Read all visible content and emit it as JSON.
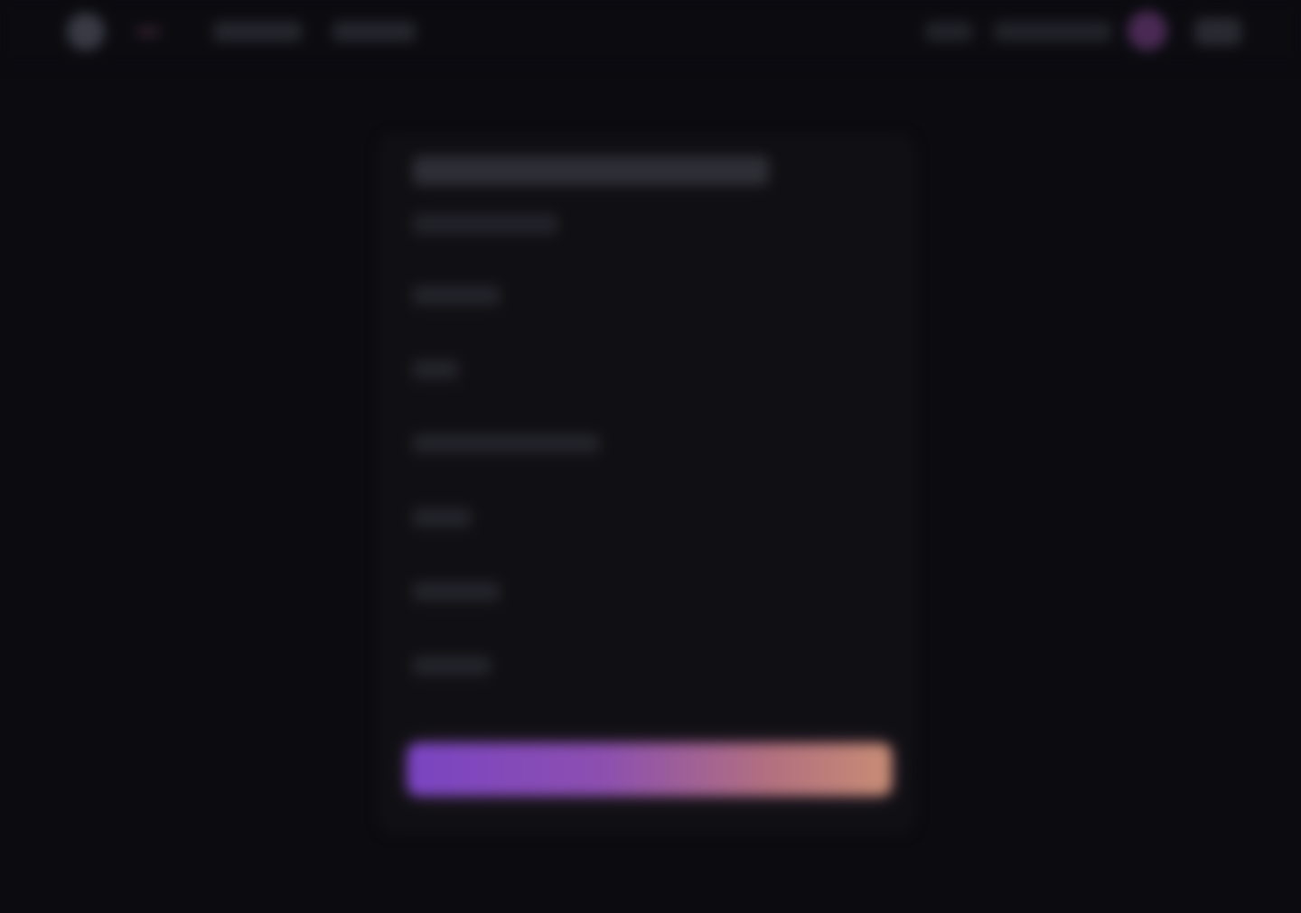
{
  "colors": {
    "background": "#0b0b10",
    "card": "#101014",
    "accent_gradient_start": "#7a44c2",
    "accent_gradient_end": "#c88d75",
    "avatar": "#4a2a54"
  },
  "header": {
    "logo_icon": "logo-icon",
    "avatar_icon": "avatar-icon",
    "menu_icon": "menu-icon"
  },
  "form": {
    "field_count": 6,
    "submit_style": "gradient-button"
  }
}
